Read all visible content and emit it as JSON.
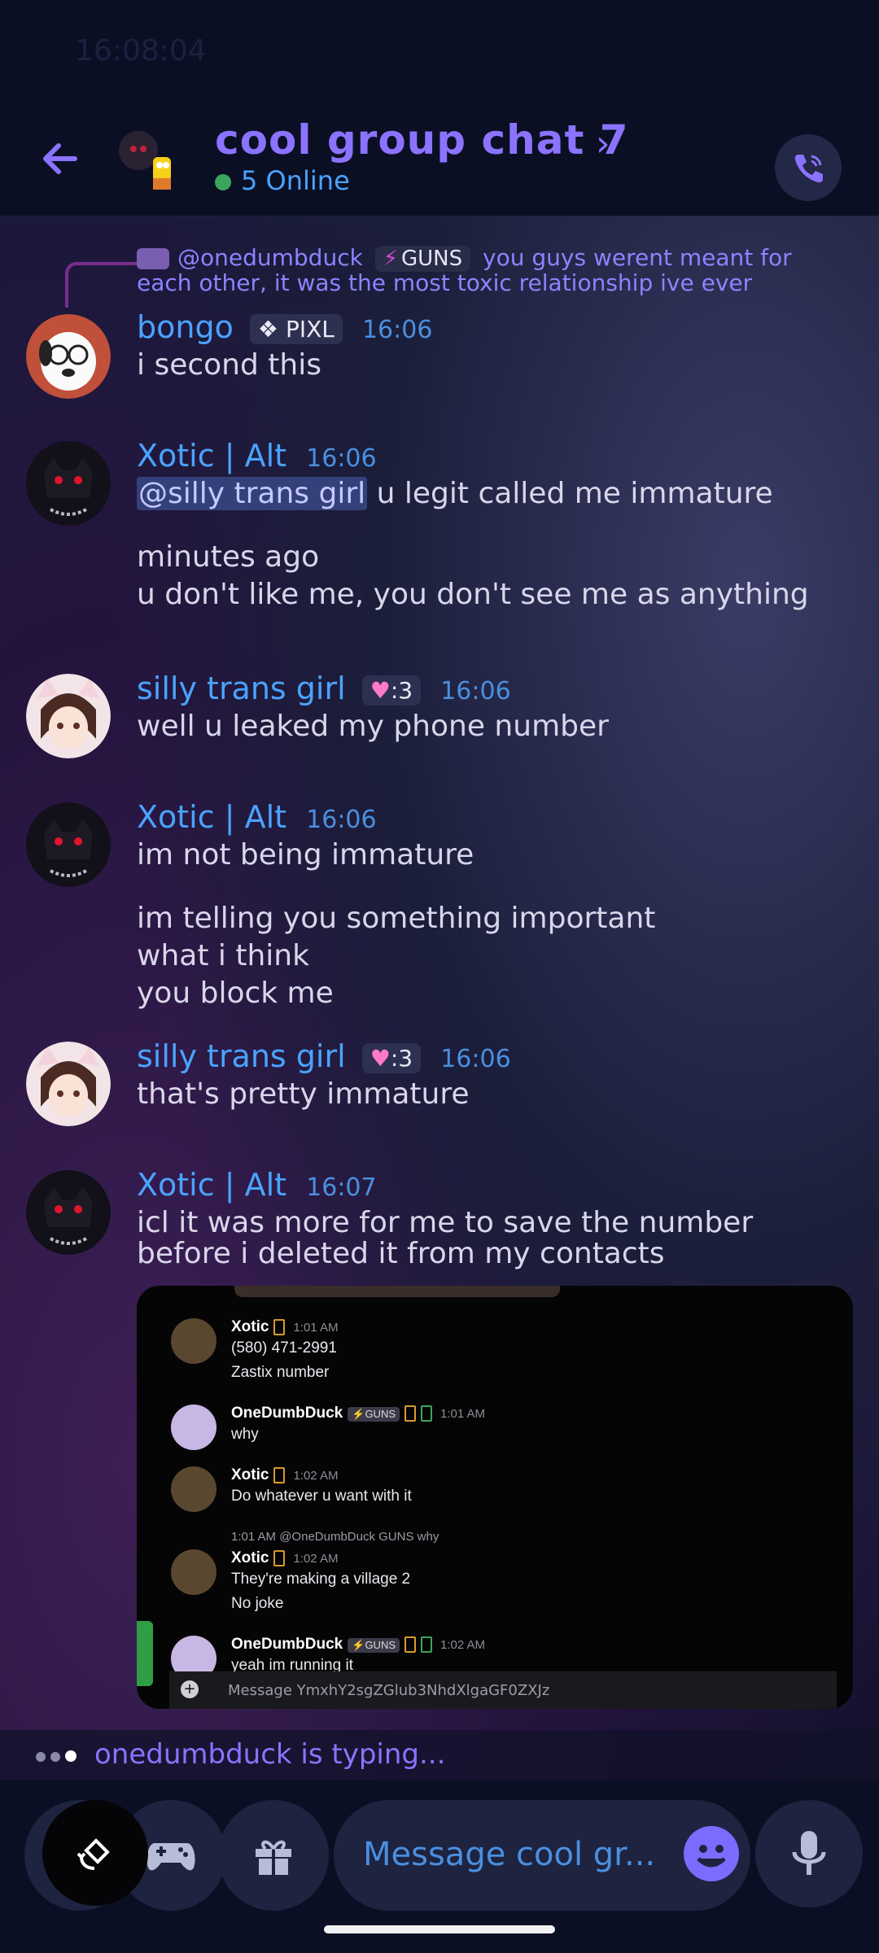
{
  "status_bar": {
    "time": "16:08:04"
  },
  "header": {
    "title": "cool group chat 7",
    "online": "5 Online"
  },
  "reply": {
    "mention": "@onedumbduck",
    "tag": "GUNS",
    "text": "you guys werent meant for each other, it was the most toxic relationship ive ever"
  },
  "messages": [
    {
      "author": "bongo",
      "badge": "PIXL",
      "time": "16:06",
      "lines": [
        "i second this"
      ]
    },
    {
      "author": "Xotic | Alt",
      "time": "16:06",
      "mention": "@silly trans girl",
      "first_line_rest": " u legit called me immature",
      "lines": [
        "minutes ago",
        "u don't like me, you don't see me as anything"
      ]
    },
    {
      "author": "silly trans girl",
      "badge": ":3",
      "time": "16:06",
      "lines": [
        "well u leaked my phone number"
      ]
    },
    {
      "author": "Xotic | Alt",
      "time": "16:06",
      "lines": [
        "im not being immature",
        "im telling you something important",
        "what i think",
        "you block me"
      ]
    },
    {
      "author": "silly trans girl",
      "badge": ":3",
      "time": "16:06",
      "lines": [
        "that's pretty immature"
      ]
    },
    {
      "author": "Xotic | Alt",
      "time": "16:07",
      "lines": [
        "icl it was more for me to save the number before i deleted it from my contacts"
      ]
    }
  ],
  "screenshot": {
    "items": [
      {
        "name": "Xotic",
        "time": "1:01 AM",
        "lines": [
          "(580) 471-2991",
          "Zastix number"
        ]
      },
      {
        "name": "OneDumbDuck",
        "tag": "GUNS",
        "time": "1:01 AM",
        "lines": [
          "why"
        ]
      },
      {
        "name": "Xotic",
        "time": "1:02 AM",
        "lines": [
          "Do whatever u want with it"
        ]
      },
      {
        "reply": "1:01 AM  @OneDumbDuck  GUNS  why",
        "name": "Xotic",
        "time": "1:02 AM",
        "lines": [
          "They're making a village 2",
          "No joke"
        ]
      },
      {
        "name": "OneDumbDuck",
        "tag": "GUNS",
        "time": "1:02 AM",
        "lines": [
          "yeah im running it"
        ]
      }
    ],
    "input_placeholder": "Message YmxhY2sgZGlub3NhdXlgaGF0ZXJz"
  },
  "typing": {
    "text": "onedumbduck is typing..."
  },
  "composer": {
    "placeholder": "Message cool gr..."
  },
  "colors": {
    "accent": "#8b73ff",
    "name_blue": "#4aa3ff",
    "background": "#0b0f24"
  }
}
